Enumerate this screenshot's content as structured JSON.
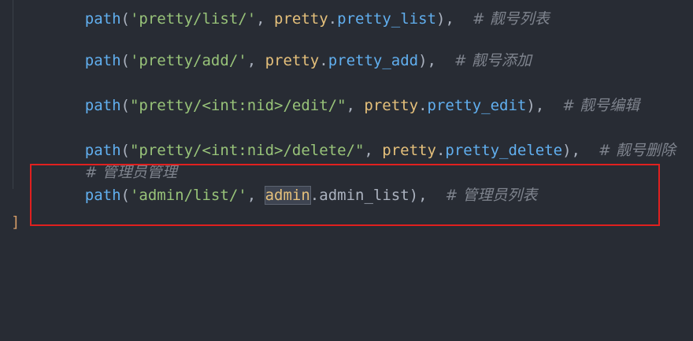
{
  "code": {
    "line0": {
      "fn": "path",
      "open": "(",
      "str": "'pretty/list/'",
      "sep": ", ",
      "mod": "pretty",
      "dot": ".",
      "attr": "pretty_list",
      "close": "),",
      "comment": "# 靓号列表"
    },
    "line1": {
      "fn": "path",
      "open": "(",
      "str": "'pretty/add/'",
      "sep": ", ",
      "mod": "pretty",
      "dot": ".",
      "attr": "pretty_add",
      "close": "),",
      "comment": "# 靓号添加"
    },
    "line2": {
      "fn": "path",
      "open": "(",
      "str": "\"pretty/<int:nid>/edit/\"",
      "sep": ", ",
      "mod": "pretty",
      "dot": ".",
      "attr": "pretty_edit",
      "close": "),",
      "comment": "# 靓号编辑"
    },
    "line3": {
      "fn": "path",
      "open": "(",
      "str": "\"pretty/<int:nid>/delete/\"",
      "sep": ", ",
      "mod": "pretty",
      "dot": ".",
      "attr": "pretty_delete",
      "close": "),",
      "comment": "# 靓号删除"
    },
    "line4": {
      "comment": "# 管理员管理"
    },
    "line5": {
      "fn": "path",
      "open": "(",
      "str": "'admin/list/'",
      "sep": ", ",
      "mod": "admin",
      "dot": ".",
      "attr": "admin_list",
      "close": "),",
      "comment": "# 管理员列表"
    },
    "closing_bracket": "]"
  },
  "colors": {
    "background": "#282c34",
    "function": "#61afef",
    "string": "#98c379",
    "module": "#e5c07b",
    "comment": "#7f848e",
    "annotation_box": "#e0201f"
  }
}
